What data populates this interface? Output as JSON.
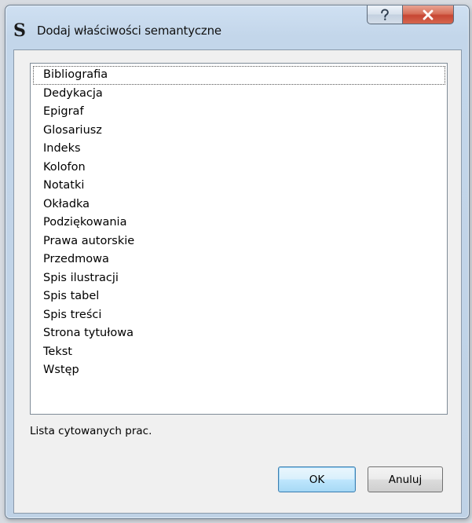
{
  "window": {
    "title": "Dodaj właściwości semantyczne",
    "icon": "sigil-s-icon"
  },
  "caption_buttons": {
    "help": "?",
    "close": "X"
  },
  "list": {
    "items": [
      "Bibliografia",
      "Dedykacja",
      "Epigraf",
      "Glosariusz",
      "Indeks",
      "Kolofon",
      "Notatki",
      "Okładka",
      "Podziękowania",
      "Prawa autorskie",
      "Przedmowa",
      "Spis ilustracji",
      "Spis tabel",
      "Spis treści",
      "Strona tytułowa",
      "Tekst",
      "Wstęp"
    ],
    "selected": "Bibliografia"
  },
  "description": "Lista cytowanych prac.",
  "buttons": {
    "ok": "OK",
    "cancel": "Anuluj"
  },
  "colors": {
    "frame": "#c3d6ea",
    "close_button": "#c74634",
    "ok_button_border": "#3c7fb1"
  }
}
